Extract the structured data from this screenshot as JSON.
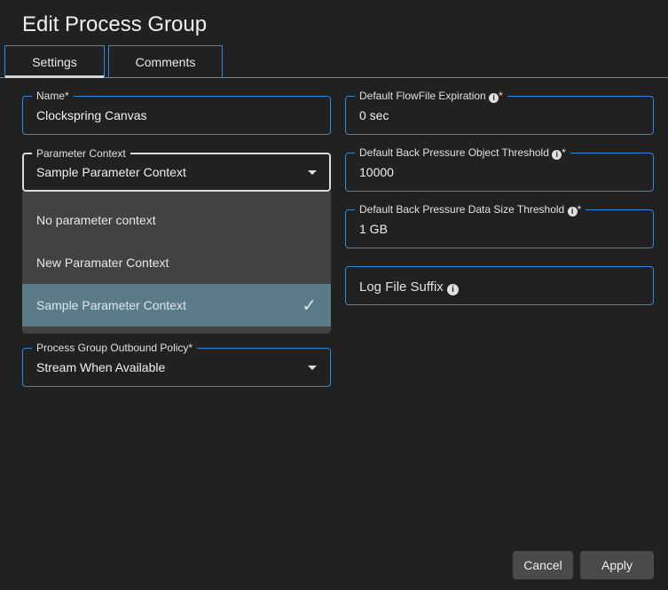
{
  "title": "Edit Process Group",
  "tabs": [
    "Settings",
    "Comments"
  ],
  "fields": {
    "name": {
      "label": "Name*",
      "value": "Clockspring Canvas"
    },
    "parameter_context": {
      "label": "Parameter Context",
      "value": "Sample Parameter Context",
      "options": [
        "No parameter context",
        "New Paramater Context",
        "Sample Parameter Context"
      ]
    },
    "outbound_policy": {
      "label": "Process Group Outbound Policy*",
      "value": "Stream When Available"
    },
    "expiration": {
      "label": "Default FlowFile Expiration",
      "req": "*",
      "value": "0 sec"
    },
    "object_threshold": {
      "label": "Default Back Pressure Object Threshold",
      "req": "*",
      "value": "10000"
    },
    "size_threshold": {
      "label": "Default Back Pressure Data Size Threshold",
      "req": "*",
      "value": "1 GB"
    },
    "log_suffix": {
      "placeholder": "Log File Suffix"
    }
  },
  "buttons": {
    "cancel": "Cancel",
    "apply": "Apply"
  },
  "colors": {
    "accent": "#2a8ae0",
    "selected": "#5b7b89"
  }
}
